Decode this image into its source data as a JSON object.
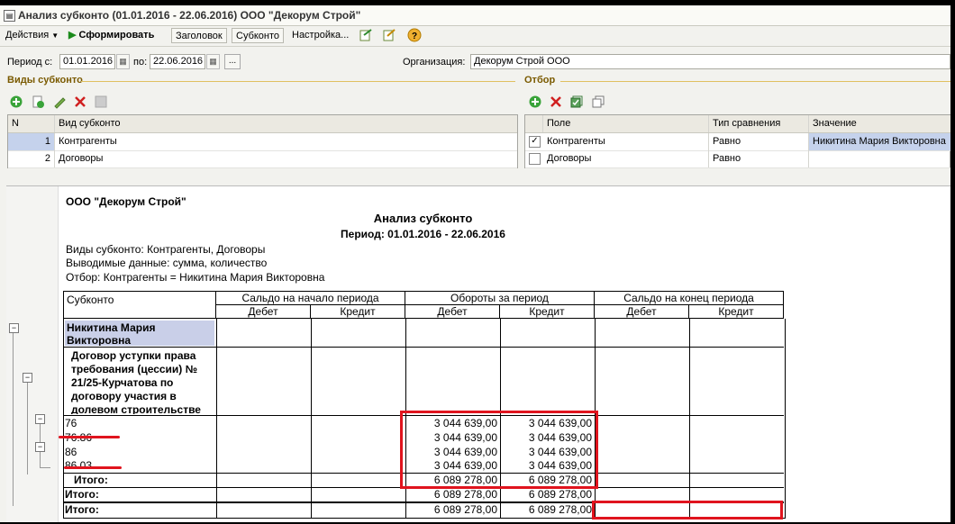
{
  "window": {
    "title": "Анализ субконто (01.01.2016 - 22.06.2016) ООО \"Декорум Строй\""
  },
  "toolbar": {
    "actions_label": "Действия",
    "generate_label": "Сформировать",
    "header_label": "Заголовок",
    "subconto_label": "Субконто",
    "settings_label": "Настройка...",
    "help_label": "?"
  },
  "filters": {
    "period_label": "Период с:",
    "period_from": "01.01.2016",
    "period_to_label": "по:",
    "period_to": "22.06.2016",
    "more_button": "...",
    "org_label": "Организация:",
    "org_value": "Декорум Строй ООО"
  },
  "subconto_types": {
    "section_title": "Виды субконто",
    "columns": [
      "N",
      "Вид субконто"
    ],
    "rows": [
      {
        "n": "1",
        "name": "Контрагенты"
      },
      {
        "n": "2",
        "name": "Договоры"
      }
    ]
  },
  "selection": {
    "section_title": "Отбор",
    "columns": [
      "Поле",
      "Тип сравнения",
      "Значение"
    ],
    "rows": [
      {
        "checked": true,
        "field": "Контрагенты",
        "compare": "Равно",
        "value": "Никитина Мария Викторовна"
      },
      {
        "checked": false,
        "field": "Договоры",
        "compare": "Равно",
        "value": ""
      }
    ]
  },
  "report": {
    "org": "ООО \"Декорум Строй\"",
    "title": "Анализ субконто",
    "period": "Период: 01.01.2016 - 22.06.2016",
    "info_types": "Виды субконто: Контрагенты, Договоры",
    "info_data": "Выводимые данные: сумма, количество",
    "info_filter": "Отбор: Контрагенты = Никитина Мария Викторовна",
    "header": {
      "subconto": "Субконто",
      "opening": "Сальдо на начало периода",
      "turnover": "Обороты за период",
      "closing": "Сальдо на конец периода",
      "debit": "Дебет",
      "credit": "Кредит"
    },
    "counterparty": "Никитина Мария Викторовна",
    "contract": "Договор уступки права требования (цессии) № 21/25-Курчатова по договору участия в долевом строительстве",
    "rows": [
      {
        "account": "76",
        "turn_debit": "3 044 639,00",
        "turn_credit": "3 044 639,00"
      },
      {
        "account": "76.86",
        "turn_debit": "3 044 639,00",
        "turn_credit": "3 044 639,00"
      },
      {
        "account": "86",
        "turn_debit": "3 044 639,00",
        "turn_credit": "3 044 639,00"
      },
      {
        "account": "86.03",
        "turn_debit": "3 044 639,00",
        "turn_credit": "3 044 639,00"
      }
    ],
    "totals": [
      {
        "label": "Итого:",
        "turn_debit": "6 089 278,00",
        "turn_credit": "6 089 278,00"
      },
      {
        "label": "Итого:",
        "turn_debit": "6 089 278,00",
        "turn_credit": "6 089 278,00"
      },
      {
        "label": "Итого:",
        "turn_debit": "6 089 278,00",
        "turn_credit": "6 089 278,00"
      }
    ]
  },
  "colors": {
    "highlight": "#e0141e",
    "selected_row": "#c5d2ec",
    "section_title": "#7a5a00"
  }
}
